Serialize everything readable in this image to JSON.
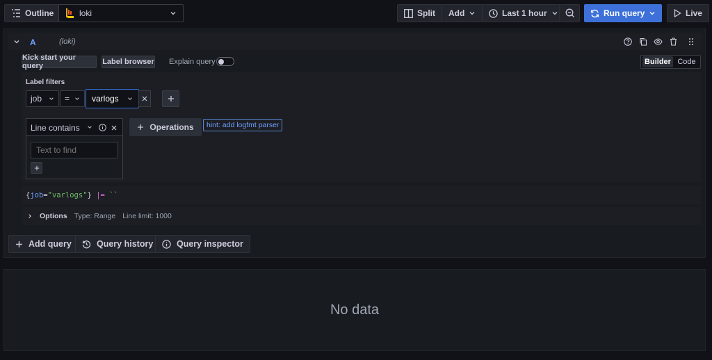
{
  "toolbar": {
    "outline_label": "Outline",
    "datasource_name": "loki",
    "split_label": "Split",
    "add_label": "Add",
    "time_range_label": "Last 1 hour",
    "run_query_label": "Run query",
    "live_label": "Live"
  },
  "query": {
    "ref_id": "A",
    "datasource_hint": "(loki)",
    "kick_start_label": "Kick start your query",
    "label_browser_label": "Label browser",
    "explain_label": "Explain query",
    "mode_builder": "Builder",
    "mode_code": "Code",
    "label_filters_title": "Label filters",
    "filter": {
      "label": "job",
      "operator": "=",
      "value": "varlogs"
    },
    "operation": {
      "title": "Line contains",
      "placeholder": "Text to find"
    },
    "operations_button": "Operations",
    "hint": "hint: add logfmt parser",
    "preview": {
      "brace_open": "{",
      "key": "job",
      "eq": "=",
      "value": "\"varlogs\"",
      "brace_close": "}",
      "op": "|=",
      "str": "``"
    },
    "options_label": "Options",
    "options_type": "Type: Range",
    "options_limit": "Line limit: 1000"
  },
  "actions": {
    "add_query": "Add query",
    "query_history": "Query history",
    "query_inspector": "Query inspector"
  },
  "results": {
    "empty_text": "No data"
  },
  "colors": {
    "accent_blue": "#3d71d9",
    "focus_blue": "#3871dc",
    "hint_border": "#5a8ad8"
  }
}
